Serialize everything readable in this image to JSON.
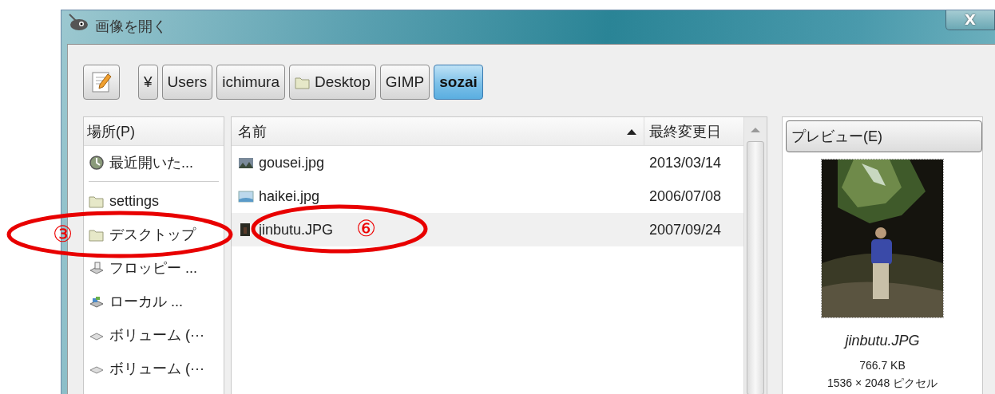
{
  "window": {
    "title": "画像を開く",
    "close_label": "X"
  },
  "path_bar": {
    "buttons": [
      {
        "label": "¥",
        "kind": "plain",
        "selected": false
      },
      {
        "label": "Users",
        "kind": "plain",
        "selected": false
      },
      {
        "label": "ichimura",
        "kind": "plain",
        "selected": false
      },
      {
        "label": "Desktop",
        "kind": "folder",
        "selected": false
      },
      {
        "label": "GIMP",
        "kind": "plain",
        "selected": false
      },
      {
        "label": "sozai",
        "kind": "plain",
        "selected": true
      }
    ]
  },
  "places": {
    "header": "場所(P)",
    "items": [
      {
        "label": "最近開いた...",
        "kind": "recent"
      },
      {
        "kind": "separator"
      },
      {
        "label": "settings",
        "kind": "folder"
      },
      {
        "label": "デスクトップ",
        "kind": "folder"
      },
      {
        "label": "フロッピー ...",
        "kind": "floppy"
      },
      {
        "label": "ローカル ...",
        "kind": "local"
      },
      {
        "label": "ボリューム (···",
        "kind": "volume"
      },
      {
        "label": "ボリューム (···",
        "kind": "volume"
      }
    ]
  },
  "files": {
    "columns": [
      "名前",
      "最終変更日"
    ],
    "rows": [
      {
        "name": "gousei.jpg",
        "modified": "2013/03/14",
        "kind": "landscape",
        "selected": false
      },
      {
        "name": "haikei.jpg",
        "modified": "2006/07/08",
        "kind": "sky",
        "selected": false
      },
      {
        "name": "jinbutu.JPG",
        "modified": "2007/09/24",
        "kind": "dark",
        "selected": true
      }
    ]
  },
  "preview": {
    "label": "プレビュー(E)",
    "filename": "jinbutu.JPG",
    "size": "766.7 KB",
    "dimensions": "1536 × 2048 ピクセル"
  },
  "annotations": [
    {
      "label": "③"
    },
    {
      "label": "⑥"
    }
  ]
}
